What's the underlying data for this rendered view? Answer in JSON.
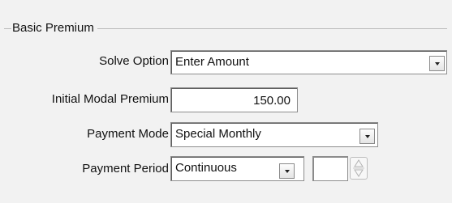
{
  "group": {
    "title": "Basic Premium"
  },
  "rows": {
    "solve_option": {
      "label": "Solve Option",
      "value": "Enter Amount",
      "dropdown_icon": "chevron-down-icon"
    },
    "initial_modal_premium": {
      "label": "Initial Modal Premium",
      "value": "150.00"
    },
    "payment_mode": {
      "label": "Payment Mode",
      "value": "Special Monthly",
      "dropdown_icon": "chevron-down-icon"
    },
    "payment_period": {
      "label": "Payment Period",
      "value": "Continuous",
      "dropdown_icon": "chevron-down-icon",
      "spinner_value": "",
      "spinner_icon": "spinner-up-down-icon"
    }
  },
  "colors": {
    "background": "#f2f2f2",
    "field_background": "#ffffff",
    "text": "#111111",
    "border": "#8d8d8d"
  }
}
